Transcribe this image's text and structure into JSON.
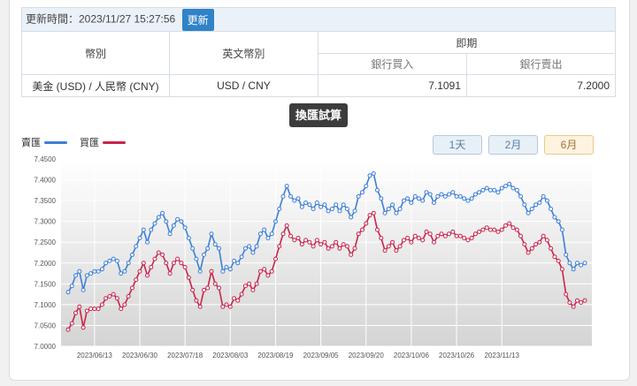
{
  "update": {
    "label": "更新時間：2023/11/27 15:27:56",
    "button": "更新"
  },
  "table": {
    "col_currency": "幣別",
    "col_english": "英文幣別",
    "col_spot": "即期",
    "col_buy": "銀行買入",
    "col_sell": "銀行賣出",
    "row": {
      "currency": "美金 (USD) / 人民幣 (CNY)",
      "english": "USD / CNY",
      "buy": "7.1091",
      "sell": "7.2000"
    }
  },
  "calc_button": "換匯試算",
  "legend": {
    "sell": "賣匯",
    "buy": "買匯"
  },
  "ranges": [
    {
      "label": "1天",
      "active": false
    },
    {
      "label": "2月",
      "active": false
    },
    {
      "label": "6月",
      "active": true
    }
  ],
  "colors": {
    "sell": "#3c7fd6",
    "buy": "#c8244b",
    "active_range": "#fdf3df"
  },
  "chart_data": {
    "type": "line",
    "title": "",
    "xlabel": "",
    "ylabel": "",
    "ylim": [
      7.0,
      7.45
    ],
    "y_ticks": [
      "7.0000",
      "7.0500",
      "7.1000",
      "7.1500",
      "7.2000",
      "7.2500",
      "7.3000",
      "7.3500",
      "7.4000",
      "7.4500"
    ],
    "x_ticks": [
      "2023/06/13",
      "2023/06/30",
      "2023/07/18",
      "2023/08/03",
      "2023/08/19",
      "2023/09/05",
      "2023/09/20",
      "2023/10/06",
      "2023/10/26",
      "2023/11/13"
    ],
    "x_tick_index": [
      7,
      19,
      31,
      43,
      55,
      67,
      79,
      91,
      103,
      115
    ],
    "grid": true,
    "series": [
      {
        "name": "賣匯",
        "values": [
          7.13,
          7.145,
          7.17,
          7.18,
          7.135,
          7.17,
          7.175,
          7.18,
          7.18,
          7.185,
          7.2,
          7.205,
          7.21,
          7.205,
          7.175,
          7.18,
          7.2,
          7.22,
          7.24,
          7.26,
          7.28,
          7.25,
          7.28,
          7.295,
          7.31,
          7.32,
          7.3,
          7.27,
          7.29,
          7.305,
          7.3,
          7.285,
          7.26,
          7.235,
          7.21,
          7.18,
          7.22,
          7.235,
          7.27,
          7.245,
          7.235,
          7.18,
          7.19,
          7.185,
          7.205,
          7.2,
          7.215,
          7.235,
          7.24,
          7.225,
          7.24,
          7.27,
          7.28,
          7.26,
          7.27,
          7.3,
          7.33,
          7.36,
          7.385,
          7.36,
          7.35,
          7.355,
          7.335,
          7.345,
          7.34,
          7.33,
          7.345,
          7.335,
          7.34,
          7.325,
          7.33,
          7.34,
          7.325,
          7.34,
          7.33,
          7.31,
          7.325,
          7.36,
          7.37,
          7.385,
          7.41,
          7.415,
          7.375,
          7.355,
          7.32,
          7.33,
          7.34,
          7.32,
          7.33,
          7.35,
          7.355,
          7.345,
          7.36,
          7.355,
          7.35,
          7.37,
          7.365,
          7.345,
          7.36,
          7.365,
          7.36,
          7.365,
          7.37,
          7.36,
          7.36,
          7.355,
          7.35,
          7.355,
          7.365,
          7.37,
          7.375,
          7.38,
          7.375,
          7.375,
          7.37,
          7.38,
          7.385,
          7.39,
          7.38,
          7.375,
          7.36,
          7.34,
          7.32,
          7.33,
          7.34,
          7.345,
          7.36,
          7.35,
          7.33,
          7.31,
          7.3,
          7.28,
          7.22,
          7.2,
          7.185,
          7.2,
          7.195,
          7.2
        ]
      },
      {
        "name": "買匯",
        "values": [
          7.04,
          7.055,
          7.08,
          7.095,
          7.045,
          7.085,
          7.09,
          7.09,
          7.09,
          7.1,
          7.115,
          7.12,
          7.125,
          7.115,
          7.09,
          7.1,
          7.12,
          7.14,
          7.16,
          7.18,
          7.2,
          7.17,
          7.19,
          7.21,
          7.225,
          7.22,
          7.2,
          7.175,
          7.2,
          7.21,
          7.2,
          7.19,
          7.165,
          7.135,
          7.11,
          7.095,
          7.135,
          7.14,
          7.18,
          7.15,
          7.14,
          7.095,
          7.1,
          7.095,
          7.115,
          7.11,
          7.125,
          7.145,
          7.15,
          7.135,
          7.15,
          7.18,
          7.185,
          7.17,
          7.18,
          7.21,
          7.24,
          7.27,
          7.29,
          7.265,
          7.255,
          7.26,
          7.245,
          7.255,
          7.25,
          7.24,
          7.255,
          7.245,
          7.25,
          7.235,
          7.24,
          7.25,
          7.235,
          7.245,
          7.24,
          7.22,
          7.235,
          7.27,
          7.28,
          7.295,
          7.315,
          7.32,
          7.28,
          7.26,
          7.23,
          7.24,
          7.25,
          7.23,
          7.24,
          7.255,
          7.26,
          7.25,
          7.265,
          7.26,
          7.255,
          7.275,
          7.27,
          7.25,
          7.265,
          7.27,
          7.265,
          7.27,
          7.275,
          7.265,
          7.265,
          7.26,
          7.255,
          7.26,
          7.27,
          7.275,
          7.28,
          7.285,
          7.28,
          7.28,
          7.275,
          7.28,
          7.29,
          7.295,
          7.285,
          7.28,
          7.265,
          7.245,
          7.225,
          7.235,
          7.245,
          7.25,
          7.265,
          7.255,
          7.235,
          7.215,
          7.205,
          7.185,
          7.125,
          7.105,
          7.095,
          7.11,
          7.105,
          7.11
        ]
      }
    ]
  }
}
